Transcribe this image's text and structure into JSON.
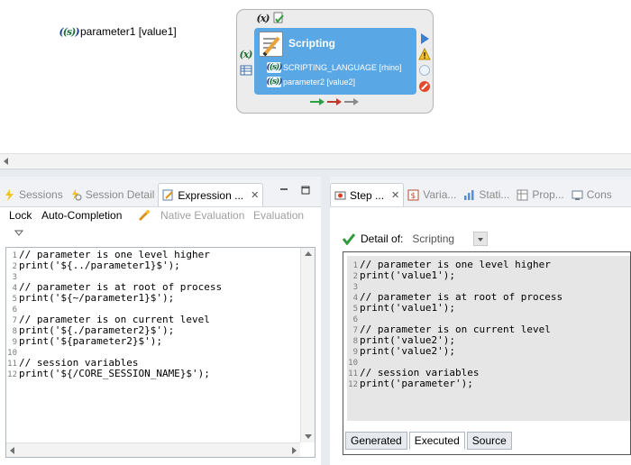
{
  "canvas": {
    "outer_param": {
      "icon": "(s)",
      "text": "parameter1 [value1]"
    },
    "task": {
      "title": "Scripting",
      "params": [
        {
          "icon": "(s)",
          "text": "SCRIPTING_LANGUAGE [rhino]"
        },
        {
          "icon": "(s)",
          "text": "parameter2 [value2]"
        }
      ],
      "top_icon": "(x)"
    }
  },
  "left_panel": {
    "tabs": [
      {
        "label": "Sessions",
        "active": false
      },
      {
        "label": "Session Detail",
        "active": false
      },
      {
        "label": "Expression ...",
        "active": true
      }
    ],
    "toolbar": {
      "lock": "Lock",
      "auto_completion": "Auto-Completion",
      "native_evaluation": "Native Evaluation",
      "evaluation": "Evaluation"
    },
    "code_lines": [
      {
        "n": "1",
        "text": "// parameter is one level higher"
      },
      {
        "n": "2",
        "text": "print('${../parameter1}$');"
      },
      {
        "n": "3",
        "text": ""
      },
      {
        "n": "4",
        "text": "// parameter is at root of process"
      },
      {
        "n": "5",
        "text": "print('${~/parameter1}$');"
      },
      {
        "n": "6",
        "text": ""
      },
      {
        "n": "7",
        "text": "// parameter is on current level"
      },
      {
        "n": "8",
        "text": "print('${./parameter2}$');"
      },
      {
        "n": "9",
        "text": "print('${parameter2}$');"
      },
      {
        "n": "10",
        "text": ""
      },
      {
        "n": "11",
        "text": "// session variables"
      },
      {
        "n": "12",
        "text": "print('${/CORE_SESSION_NAME}$');"
      }
    ]
  },
  "right_panel": {
    "tabs": [
      {
        "label": "Step ...",
        "active": true
      },
      {
        "label": "Varia...",
        "active": false
      },
      {
        "label": "Stati...",
        "active": false
      },
      {
        "label": "Prop...",
        "active": false
      },
      {
        "label": "Cons",
        "active": false
      }
    ],
    "detail_label": "Detail of:",
    "detail_value": "Scripting",
    "code_lines": [
      {
        "n": "1",
        "text": "// parameter is one level higher"
      },
      {
        "n": "2",
        "text": "print('value1');"
      },
      {
        "n": "3",
        "text": ""
      },
      {
        "n": "4",
        "text": "// parameter is at root of process"
      },
      {
        "n": "5",
        "text": "print('value1');"
      },
      {
        "n": "6",
        "text": ""
      },
      {
        "n": "7",
        "text": "// parameter is on current level"
      },
      {
        "n": "8",
        "text": "print('value2');"
      },
      {
        "n": "9",
        "text": "print('value2');"
      },
      {
        "n": "10",
        "text": ""
      },
      {
        "n": "11",
        "text": "// session variables"
      },
      {
        "n": "12",
        "text": "print('parameter');"
      }
    ],
    "bottom_tabs": [
      {
        "label": "Generated",
        "active": false
      },
      {
        "label": "Executed",
        "active": true
      },
      {
        "label": "Source",
        "active": false
      }
    ]
  }
}
